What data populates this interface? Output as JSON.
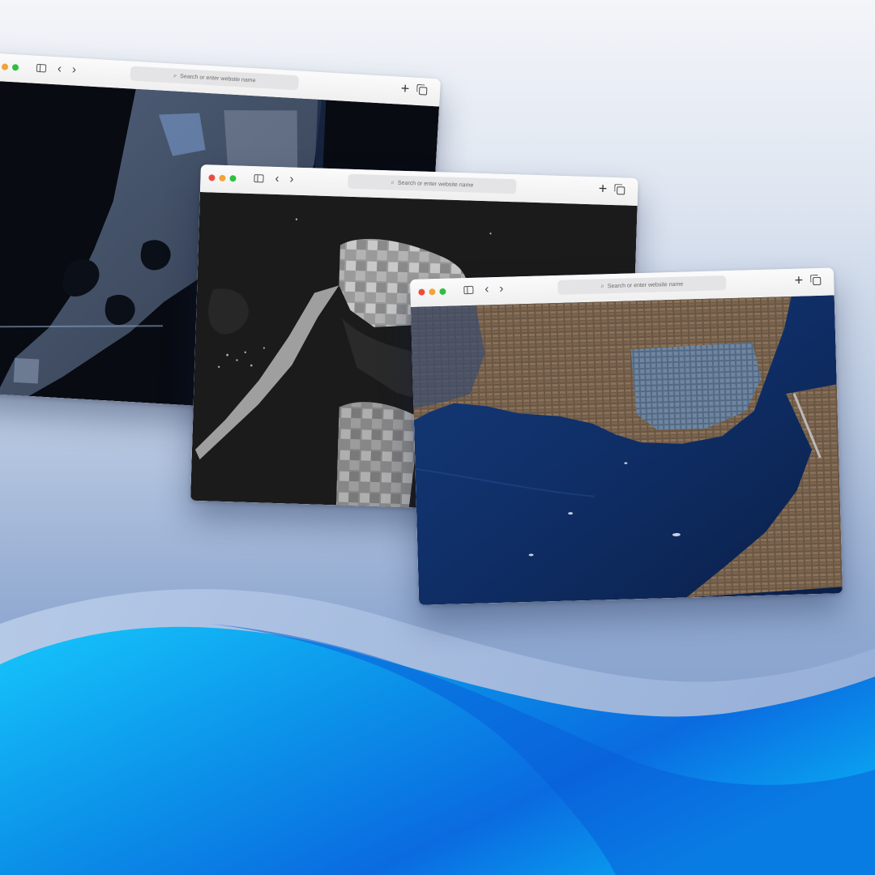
{
  "theme": {
    "wave_light": "#18c4fb",
    "wave_dark": "#0857d6",
    "wave_soft": "#a9c2e4"
  },
  "windows": [
    {
      "id": "coastal-sar-dark",
      "toolbar": {
        "address_placeholder": "Search or enter website name",
        "search_icon": "magnifier-icon",
        "back_label": "‹",
        "forward_label": "›",
        "new_tab_label": "+",
        "icons": [
          "sidebar-icon",
          "chevron-left-icon",
          "chevron-right-icon",
          "plus-icon",
          "tabs-overview-icon"
        ]
      }
    },
    {
      "id": "peninsula-sar-grayscale",
      "toolbar": {
        "address_placeholder": "Search or enter website name",
        "search_icon": "magnifier-icon",
        "back_label": "‹",
        "forward_label": "›",
        "new_tab_label": "+",
        "icons": [
          "sidebar-icon",
          "chevron-left-icon",
          "chevron-right-icon",
          "plus-icon",
          "tabs-overview-icon"
        ]
      }
    },
    {
      "id": "harbor-city-optical",
      "toolbar": {
        "address_placeholder": "Search or enter website name",
        "search_icon": "magnifier-icon",
        "back_label": "‹",
        "forward_label": "›",
        "new_tab_label": "+",
        "icons": [
          "sidebar-icon",
          "chevron-left-icon",
          "chevron-right-icon",
          "plus-icon",
          "tabs-overview-icon"
        ]
      }
    }
  ]
}
